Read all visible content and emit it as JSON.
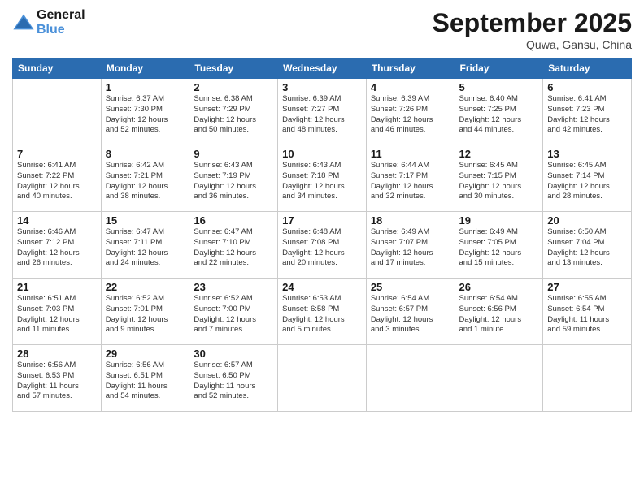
{
  "header": {
    "logo_line1": "General",
    "logo_line2": "Blue",
    "month_title": "September 2025",
    "location": "Quwa, Gansu, China"
  },
  "weekdays": [
    "Sunday",
    "Monday",
    "Tuesday",
    "Wednesday",
    "Thursday",
    "Friday",
    "Saturday"
  ],
  "weeks": [
    [
      {
        "day": "",
        "info": ""
      },
      {
        "day": "1",
        "info": "Sunrise: 6:37 AM\nSunset: 7:30 PM\nDaylight: 12 hours\nand 52 minutes."
      },
      {
        "day": "2",
        "info": "Sunrise: 6:38 AM\nSunset: 7:29 PM\nDaylight: 12 hours\nand 50 minutes."
      },
      {
        "day": "3",
        "info": "Sunrise: 6:39 AM\nSunset: 7:27 PM\nDaylight: 12 hours\nand 48 minutes."
      },
      {
        "day": "4",
        "info": "Sunrise: 6:39 AM\nSunset: 7:26 PM\nDaylight: 12 hours\nand 46 minutes."
      },
      {
        "day": "5",
        "info": "Sunrise: 6:40 AM\nSunset: 7:25 PM\nDaylight: 12 hours\nand 44 minutes."
      },
      {
        "day": "6",
        "info": "Sunrise: 6:41 AM\nSunset: 7:23 PM\nDaylight: 12 hours\nand 42 minutes."
      }
    ],
    [
      {
        "day": "7",
        "info": "Sunrise: 6:41 AM\nSunset: 7:22 PM\nDaylight: 12 hours\nand 40 minutes."
      },
      {
        "day": "8",
        "info": "Sunrise: 6:42 AM\nSunset: 7:21 PM\nDaylight: 12 hours\nand 38 minutes."
      },
      {
        "day": "9",
        "info": "Sunrise: 6:43 AM\nSunset: 7:19 PM\nDaylight: 12 hours\nand 36 minutes."
      },
      {
        "day": "10",
        "info": "Sunrise: 6:43 AM\nSunset: 7:18 PM\nDaylight: 12 hours\nand 34 minutes."
      },
      {
        "day": "11",
        "info": "Sunrise: 6:44 AM\nSunset: 7:17 PM\nDaylight: 12 hours\nand 32 minutes."
      },
      {
        "day": "12",
        "info": "Sunrise: 6:45 AM\nSunset: 7:15 PM\nDaylight: 12 hours\nand 30 minutes."
      },
      {
        "day": "13",
        "info": "Sunrise: 6:45 AM\nSunset: 7:14 PM\nDaylight: 12 hours\nand 28 minutes."
      }
    ],
    [
      {
        "day": "14",
        "info": "Sunrise: 6:46 AM\nSunset: 7:12 PM\nDaylight: 12 hours\nand 26 minutes."
      },
      {
        "day": "15",
        "info": "Sunrise: 6:47 AM\nSunset: 7:11 PM\nDaylight: 12 hours\nand 24 minutes."
      },
      {
        "day": "16",
        "info": "Sunrise: 6:47 AM\nSunset: 7:10 PM\nDaylight: 12 hours\nand 22 minutes."
      },
      {
        "day": "17",
        "info": "Sunrise: 6:48 AM\nSunset: 7:08 PM\nDaylight: 12 hours\nand 20 minutes."
      },
      {
        "day": "18",
        "info": "Sunrise: 6:49 AM\nSunset: 7:07 PM\nDaylight: 12 hours\nand 17 minutes."
      },
      {
        "day": "19",
        "info": "Sunrise: 6:49 AM\nSunset: 7:05 PM\nDaylight: 12 hours\nand 15 minutes."
      },
      {
        "day": "20",
        "info": "Sunrise: 6:50 AM\nSunset: 7:04 PM\nDaylight: 12 hours\nand 13 minutes."
      }
    ],
    [
      {
        "day": "21",
        "info": "Sunrise: 6:51 AM\nSunset: 7:03 PM\nDaylight: 12 hours\nand 11 minutes."
      },
      {
        "day": "22",
        "info": "Sunrise: 6:52 AM\nSunset: 7:01 PM\nDaylight: 12 hours\nand 9 minutes."
      },
      {
        "day": "23",
        "info": "Sunrise: 6:52 AM\nSunset: 7:00 PM\nDaylight: 12 hours\nand 7 minutes."
      },
      {
        "day": "24",
        "info": "Sunrise: 6:53 AM\nSunset: 6:58 PM\nDaylight: 12 hours\nand 5 minutes."
      },
      {
        "day": "25",
        "info": "Sunrise: 6:54 AM\nSunset: 6:57 PM\nDaylight: 12 hours\nand 3 minutes."
      },
      {
        "day": "26",
        "info": "Sunrise: 6:54 AM\nSunset: 6:56 PM\nDaylight: 12 hours\nand 1 minute."
      },
      {
        "day": "27",
        "info": "Sunrise: 6:55 AM\nSunset: 6:54 PM\nDaylight: 11 hours\nand 59 minutes."
      }
    ],
    [
      {
        "day": "28",
        "info": "Sunrise: 6:56 AM\nSunset: 6:53 PM\nDaylight: 11 hours\nand 57 minutes."
      },
      {
        "day": "29",
        "info": "Sunrise: 6:56 AM\nSunset: 6:51 PM\nDaylight: 11 hours\nand 54 minutes."
      },
      {
        "day": "30",
        "info": "Sunrise: 6:57 AM\nSunset: 6:50 PM\nDaylight: 11 hours\nand 52 minutes."
      },
      {
        "day": "",
        "info": ""
      },
      {
        "day": "",
        "info": ""
      },
      {
        "day": "",
        "info": ""
      },
      {
        "day": "",
        "info": ""
      }
    ]
  ]
}
